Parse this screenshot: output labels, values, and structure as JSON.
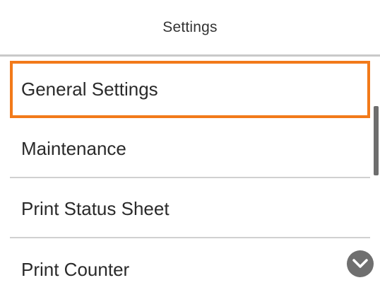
{
  "header": {
    "title": "Settings"
  },
  "menu": {
    "items": [
      {
        "label": "General Settings",
        "selected": true
      },
      {
        "label": "Maintenance",
        "selected": false
      },
      {
        "label": "Print Status Sheet",
        "selected": false
      },
      {
        "label": "Print Counter",
        "selected": false
      }
    ]
  },
  "icons": {
    "scroll_down": "chevron-down-icon"
  },
  "colors": {
    "selection_border": "#f27a1a",
    "scroll_button": "#6f6f6f",
    "scrollbar_thumb": "#6e6e6e"
  }
}
